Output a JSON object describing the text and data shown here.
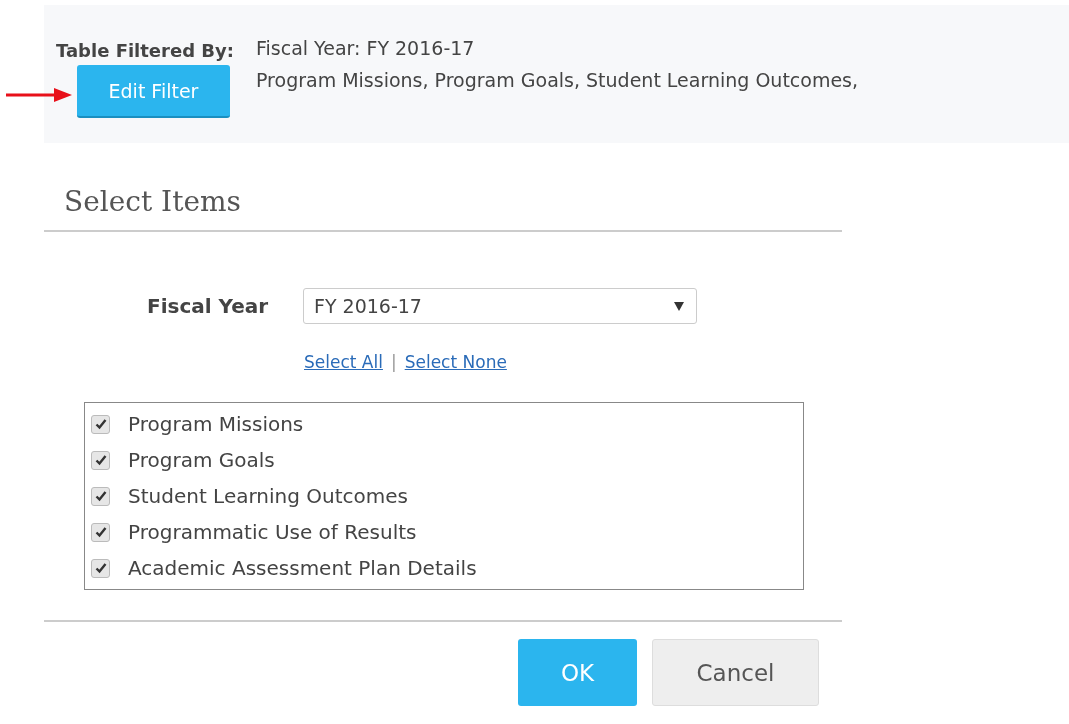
{
  "filter_summary": {
    "label": "Table Filtered By:",
    "button": "Edit Filter",
    "lines": [
      "Fiscal Year: FY 2016-17",
      "Program Missions, Program Goals, Student Learning Outcomes,"
    ]
  },
  "dialog": {
    "title": "Select Items",
    "fiscal_year": {
      "label": "Fiscal Year",
      "value": "FY 2016-17"
    },
    "links": [
      "Select All",
      "Select None"
    ],
    "separator": "|",
    "items": [
      {
        "label": "Program Missions",
        "checked": true
      },
      {
        "label": "Program Goals",
        "checked": true
      },
      {
        "label": "Student Learning Outcomes",
        "checked": true
      },
      {
        "label": "Programmatic Use of Results",
        "checked": true
      },
      {
        "label": "Academic Assessment Plan Details",
        "checked": true
      }
    ],
    "buttons": [
      "OK",
      "Cancel"
    ]
  }
}
